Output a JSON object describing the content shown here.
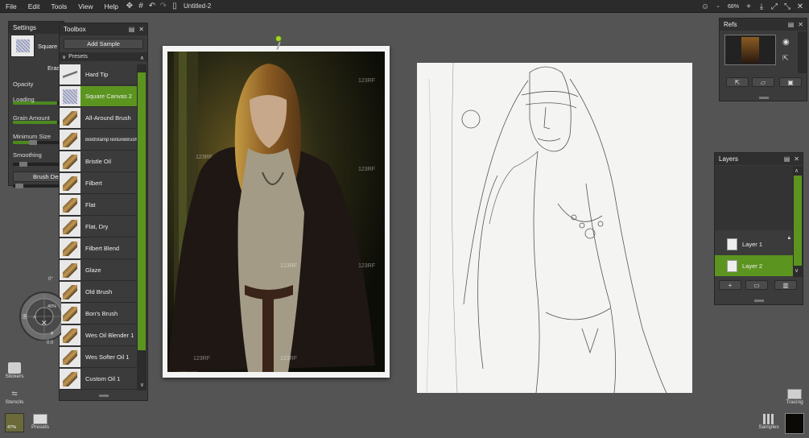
{
  "menubar": {
    "items": [
      "File",
      "Edit",
      "Tools",
      "View",
      "Help"
    ],
    "doc_title": "Untitled-2",
    "zoom": "68%"
  },
  "settings": {
    "title": "Settings",
    "brush_name": "Square",
    "erase_label": "Erase",
    "opacity_label": "Opacity",
    "loading_label": "Loading",
    "grain_label": "Grain Amount",
    "min_size_label": "Minimum Size",
    "smoothing_label": "Smoothing",
    "brush_designer_label": "Brush Des",
    "opacity_value": 0.95,
    "loading_value": 0.95,
    "grain_value": 0.45,
    "min_size_value": 0.2,
    "smoothing_value": 0.15
  },
  "toolbox": {
    "title": "Toolbox",
    "add_sample": "Add Sample",
    "presets_label": "Presets",
    "presets": [
      {
        "name": "Hard Tip",
        "selected": false
      },
      {
        "name": "Square Canvas 2",
        "selected": true
      },
      {
        "name": "All-Around Brush",
        "selected": false
      },
      {
        "name": "BoldStampTextureBrush",
        "selected": false
      },
      {
        "name": "Bristle Oil",
        "selected": false
      },
      {
        "name": "Filbert",
        "selected": false
      },
      {
        "name": "Flat",
        "selected": false
      },
      {
        "name": "Flat, Dry",
        "selected": false
      },
      {
        "name": "Filbert Blend",
        "selected": false
      },
      {
        "name": "Glaze",
        "selected": false
      },
      {
        "name": "Old Brush",
        "selected": false
      },
      {
        "name": "Bon's Brush",
        "selected": false
      },
      {
        "name": "Wes Oil Blender 1",
        "selected": false
      },
      {
        "name": "Wes Softer Oil 1",
        "selected": false
      },
      {
        "name": "Custom Oil 1",
        "selected": false
      }
    ]
  },
  "nav_wheel": {
    "top_label": "0°",
    "mid_label": "40%",
    "left_label": "90",
    "bottom_label": "0:0"
  },
  "left_dock": {
    "stickers": "Stickers",
    "stencils": "Stencils",
    "presets": "Presets",
    "percent": "47%"
  },
  "photo": {
    "watermarks": [
      "123RF",
      "123RF",
      "123RF",
      "123RF",
      "123RF",
      "123RF",
      "123RF"
    ]
  },
  "refs": {
    "title": "Refs"
  },
  "layers": {
    "title": "Layers",
    "items": [
      {
        "name": "Layer 1",
        "selected": false
      },
      {
        "name": "Layer 2",
        "selected": true
      }
    ]
  },
  "right_dock": {
    "tracing": "Tracing",
    "samples": "Samples"
  },
  "colors": {
    "accent": "#5c9420",
    "panel": "#3b3b3b",
    "background": "#545454"
  }
}
